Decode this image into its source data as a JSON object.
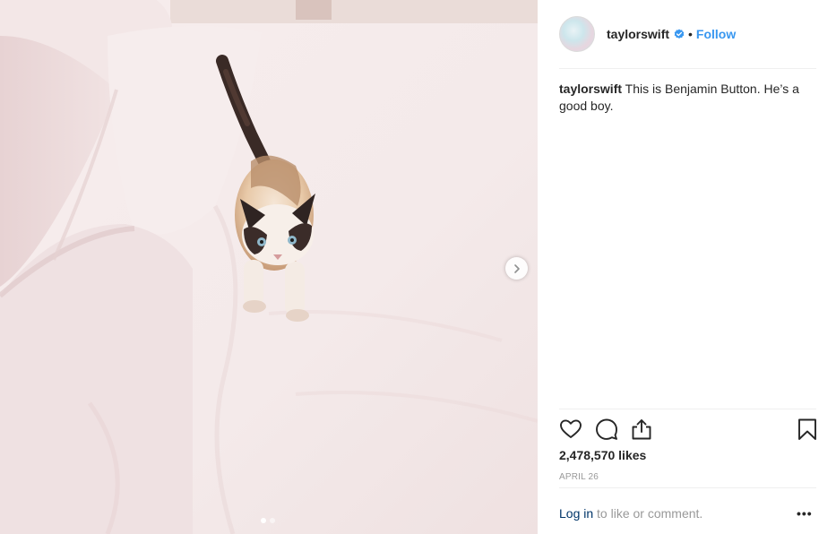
{
  "post": {
    "username": "taylorswift",
    "verified": true,
    "separator": "•",
    "follow_label": "Follow",
    "caption_user": "taylorswift",
    "caption_text": " This is Benjamin Button. He’s a good boy.",
    "likes_text": "2,478,570 likes",
    "date": "APRIL 26",
    "login_link": "Log in",
    "login_rest": " to like or comment.",
    "more_label": "•••",
    "carousel_dots": 2,
    "active_dot": 1
  },
  "icons": {
    "next": "chevron-right-icon",
    "like": "heart-icon",
    "comment": "comment-bubble-icon",
    "share": "share-upload-icon",
    "save": "bookmark-icon",
    "verified": "verified-badge-icon"
  },
  "colors": {
    "link_blue": "#3897f0",
    "login_link": "#003569",
    "muted_text": "#999999",
    "divider": "#efefef"
  }
}
